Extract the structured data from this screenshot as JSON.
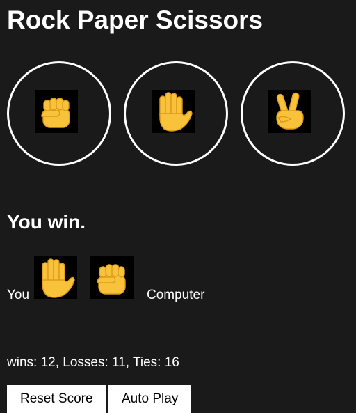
{
  "header": {
    "title": "Rock Paper Scissors"
  },
  "moves": {
    "rock": {
      "icon": "rock-fist-icon"
    },
    "paper": {
      "icon": "paper-hand-icon"
    },
    "scissors": {
      "icon": "scissors-peace-icon"
    }
  },
  "result": {
    "text": "You win.",
    "player_label": "You",
    "computer_label": "Computer",
    "player_move_icon": "paper-hand-icon",
    "computer_move_icon": "rock-fist-icon"
  },
  "score": {
    "text": "wins: 12, Losses: 11, Ties: 16"
  },
  "buttons": {
    "reset_label": "Reset Score",
    "autoplay_label": "Auto Play"
  },
  "colors": {
    "background": "#1a1a1a",
    "text": "#ffffff",
    "emoji_skin": "#f8c23a",
    "emoji_shade": "#dd9b1a",
    "tile_background": "#000000"
  }
}
